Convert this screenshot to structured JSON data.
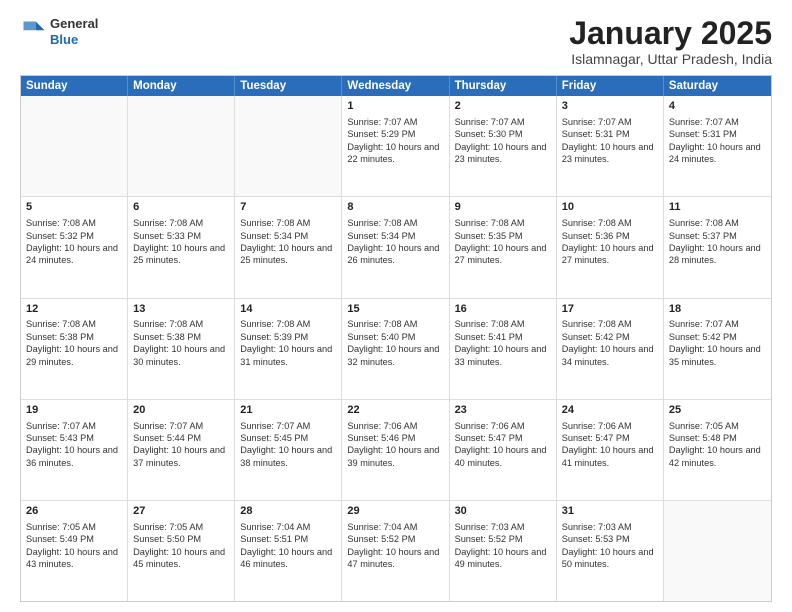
{
  "header": {
    "logo": {
      "general": "General",
      "blue": "Blue"
    },
    "month_title": "January 2025",
    "subtitle": "Islamnagar, Uttar Pradesh, India"
  },
  "calendar": {
    "weekdays": [
      "Sunday",
      "Monday",
      "Tuesday",
      "Wednesday",
      "Thursday",
      "Friday",
      "Saturday"
    ],
    "weeks": [
      [
        {
          "day": "",
          "empty": true
        },
        {
          "day": "",
          "empty": true
        },
        {
          "day": "",
          "empty": true
        },
        {
          "day": "1",
          "sunrise": "Sunrise: 7:07 AM",
          "sunset": "Sunset: 5:29 PM",
          "daylight": "Daylight: 10 hours and 22 minutes."
        },
        {
          "day": "2",
          "sunrise": "Sunrise: 7:07 AM",
          "sunset": "Sunset: 5:30 PM",
          "daylight": "Daylight: 10 hours and 23 minutes."
        },
        {
          "day": "3",
          "sunrise": "Sunrise: 7:07 AM",
          "sunset": "Sunset: 5:31 PM",
          "daylight": "Daylight: 10 hours and 23 minutes."
        },
        {
          "day": "4",
          "sunrise": "Sunrise: 7:07 AM",
          "sunset": "Sunset: 5:31 PM",
          "daylight": "Daylight: 10 hours and 24 minutes."
        }
      ],
      [
        {
          "day": "5",
          "sunrise": "Sunrise: 7:08 AM",
          "sunset": "Sunset: 5:32 PM",
          "daylight": "Daylight: 10 hours and 24 minutes."
        },
        {
          "day": "6",
          "sunrise": "Sunrise: 7:08 AM",
          "sunset": "Sunset: 5:33 PM",
          "daylight": "Daylight: 10 hours and 25 minutes."
        },
        {
          "day": "7",
          "sunrise": "Sunrise: 7:08 AM",
          "sunset": "Sunset: 5:34 PM",
          "daylight": "Daylight: 10 hours and 25 minutes."
        },
        {
          "day": "8",
          "sunrise": "Sunrise: 7:08 AM",
          "sunset": "Sunset: 5:34 PM",
          "daylight": "Daylight: 10 hours and 26 minutes."
        },
        {
          "day": "9",
          "sunrise": "Sunrise: 7:08 AM",
          "sunset": "Sunset: 5:35 PM",
          "daylight": "Daylight: 10 hours and 27 minutes."
        },
        {
          "day": "10",
          "sunrise": "Sunrise: 7:08 AM",
          "sunset": "Sunset: 5:36 PM",
          "daylight": "Daylight: 10 hours and 27 minutes."
        },
        {
          "day": "11",
          "sunrise": "Sunrise: 7:08 AM",
          "sunset": "Sunset: 5:37 PM",
          "daylight": "Daylight: 10 hours and 28 minutes."
        }
      ],
      [
        {
          "day": "12",
          "sunrise": "Sunrise: 7:08 AM",
          "sunset": "Sunset: 5:38 PM",
          "daylight": "Daylight: 10 hours and 29 minutes."
        },
        {
          "day": "13",
          "sunrise": "Sunrise: 7:08 AM",
          "sunset": "Sunset: 5:38 PM",
          "daylight": "Daylight: 10 hours and 30 minutes."
        },
        {
          "day": "14",
          "sunrise": "Sunrise: 7:08 AM",
          "sunset": "Sunset: 5:39 PM",
          "daylight": "Daylight: 10 hours and 31 minutes."
        },
        {
          "day": "15",
          "sunrise": "Sunrise: 7:08 AM",
          "sunset": "Sunset: 5:40 PM",
          "daylight": "Daylight: 10 hours and 32 minutes."
        },
        {
          "day": "16",
          "sunrise": "Sunrise: 7:08 AM",
          "sunset": "Sunset: 5:41 PM",
          "daylight": "Daylight: 10 hours and 33 minutes."
        },
        {
          "day": "17",
          "sunrise": "Sunrise: 7:08 AM",
          "sunset": "Sunset: 5:42 PM",
          "daylight": "Daylight: 10 hours and 34 minutes."
        },
        {
          "day": "18",
          "sunrise": "Sunrise: 7:07 AM",
          "sunset": "Sunset: 5:42 PM",
          "daylight": "Daylight: 10 hours and 35 minutes."
        }
      ],
      [
        {
          "day": "19",
          "sunrise": "Sunrise: 7:07 AM",
          "sunset": "Sunset: 5:43 PM",
          "daylight": "Daylight: 10 hours and 36 minutes."
        },
        {
          "day": "20",
          "sunrise": "Sunrise: 7:07 AM",
          "sunset": "Sunset: 5:44 PM",
          "daylight": "Daylight: 10 hours and 37 minutes."
        },
        {
          "day": "21",
          "sunrise": "Sunrise: 7:07 AM",
          "sunset": "Sunset: 5:45 PM",
          "daylight": "Daylight: 10 hours and 38 minutes."
        },
        {
          "day": "22",
          "sunrise": "Sunrise: 7:06 AM",
          "sunset": "Sunset: 5:46 PM",
          "daylight": "Daylight: 10 hours and 39 minutes."
        },
        {
          "day": "23",
          "sunrise": "Sunrise: 7:06 AM",
          "sunset": "Sunset: 5:47 PM",
          "daylight": "Daylight: 10 hours and 40 minutes."
        },
        {
          "day": "24",
          "sunrise": "Sunrise: 7:06 AM",
          "sunset": "Sunset: 5:47 PM",
          "daylight": "Daylight: 10 hours and 41 minutes."
        },
        {
          "day": "25",
          "sunrise": "Sunrise: 7:05 AM",
          "sunset": "Sunset: 5:48 PM",
          "daylight": "Daylight: 10 hours and 42 minutes."
        }
      ],
      [
        {
          "day": "26",
          "sunrise": "Sunrise: 7:05 AM",
          "sunset": "Sunset: 5:49 PM",
          "daylight": "Daylight: 10 hours and 43 minutes."
        },
        {
          "day": "27",
          "sunrise": "Sunrise: 7:05 AM",
          "sunset": "Sunset: 5:50 PM",
          "daylight": "Daylight: 10 hours and 45 minutes."
        },
        {
          "day": "28",
          "sunrise": "Sunrise: 7:04 AM",
          "sunset": "Sunset: 5:51 PM",
          "daylight": "Daylight: 10 hours and 46 minutes."
        },
        {
          "day": "29",
          "sunrise": "Sunrise: 7:04 AM",
          "sunset": "Sunset: 5:52 PM",
          "daylight": "Daylight: 10 hours and 47 minutes."
        },
        {
          "day": "30",
          "sunrise": "Sunrise: 7:03 AM",
          "sunset": "Sunset: 5:52 PM",
          "daylight": "Daylight: 10 hours and 49 minutes."
        },
        {
          "day": "31",
          "sunrise": "Sunrise: 7:03 AM",
          "sunset": "Sunset: 5:53 PM",
          "daylight": "Daylight: 10 hours and 50 minutes."
        },
        {
          "day": "",
          "empty": true
        }
      ]
    ]
  }
}
